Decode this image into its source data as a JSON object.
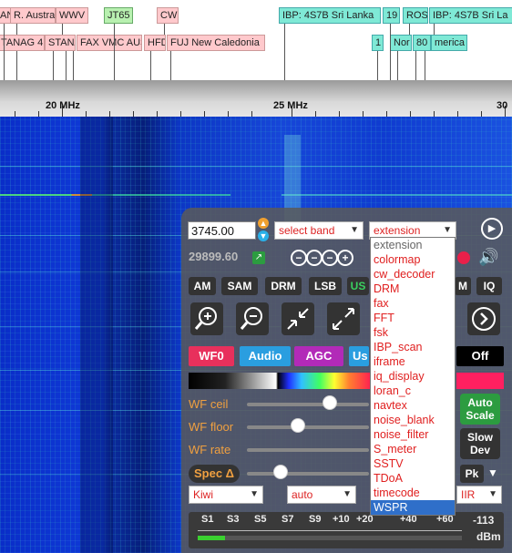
{
  "labels_top": [
    {
      "text": "AN",
      "color": "pink"
    },
    {
      "text": "R. Austra",
      "color": "pink"
    },
    {
      "text": "WWV",
      "color": "pink"
    },
    {
      "text": "JT65",
      "color": "green"
    },
    {
      "text": "CW",
      "color": "pink"
    },
    {
      "text": "IBP: 4S7B Sri Lanka",
      "color": "cyan"
    },
    {
      "text": "19",
      "color": "cyan"
    },
    {
      "text": "ROS",
      "color": "cyan"
    },
    {
      "text": "IBP: 4S7B Sri La",
      "color": "cyan"
    }
  ],
  "labels_bottom": [
    {
      "text": "TANAG 4",
      "color": "pink"
    },
    {
      "text": "STANA",
      "color": "pink"
    },
    {
      "text": "FAX VMC AUS",
      "color": "pink"
    },
    {
      "text": "HFD",
      "color": "pink"
    },
    {
      "text": "FUJ New Caledonia",
      "color": "pink"
    },
    {
      "text": "1",
      "color": "cyan"
    },
    {
      "text": "Nor",
      "color": "cyan"
    },
    {
      "text": "80",
      "color": "cyan"
    },
    {
      "text": "merica",
      "color": "cyan"
    }
  ],
  "scale": {
    "m20": "20 MHz",
    "m25": "25 MHz",
    "m30": "30"
  },
  "panel": {
    "freq_value": "3745.00",
    "band_select": "select band",
    "ext_select": "extension",
    "freq_readout": "29899.60",
    "modes": [
      "AM",
      "SAM",
      "DRM",
      "LSB",
      "US",
      "M",
      "IQ"
    ],
    "buttons": {
      "wf0": "WF0",
      "audio": "Audio",
      "agc": "AGC",
      "us": "Us",
      "off": "Off",
      "auto_scale": "Auto Scale",
      "slow_dev": "Slow Dev",
      "pk": "Pk"
    },
    "sliders": {
      "wf_ceil": "WF ceil",
      "wf_floor": "WF floor",
      "wf_rate": "WF rate",
      "spec": "Spec Δ"
    },
    "selects": {
      "kiwi": "Kiwi",
      "auto": "auto",
      "iir": "IIR"
    },
    "smeter": {
      "marks": [
        "S1",
        "S3",
        "S5",
        "S7",
        "S9",
        "+10",
        "+20",
        "+40",
        "+60",
        "-113"
      ],
      "unit": "dBm"
    }
  },
  "extension_options": [
    "extension",
    "colormap",
    "cw_decoder",
    "DRM",
    "fax",
    "FFT",
    "fsk",
    "IBP_scan",
    "iframe",
    "iq_display",
    "loran_c",
    "navtex",
    "noise_blank",
    "noise_filter",
    "S_meter",
    "SSTV",
    "TDoA",
    "timecode",
    "WSPR"
  ],
  "extension_selected": "WSPR"
}
